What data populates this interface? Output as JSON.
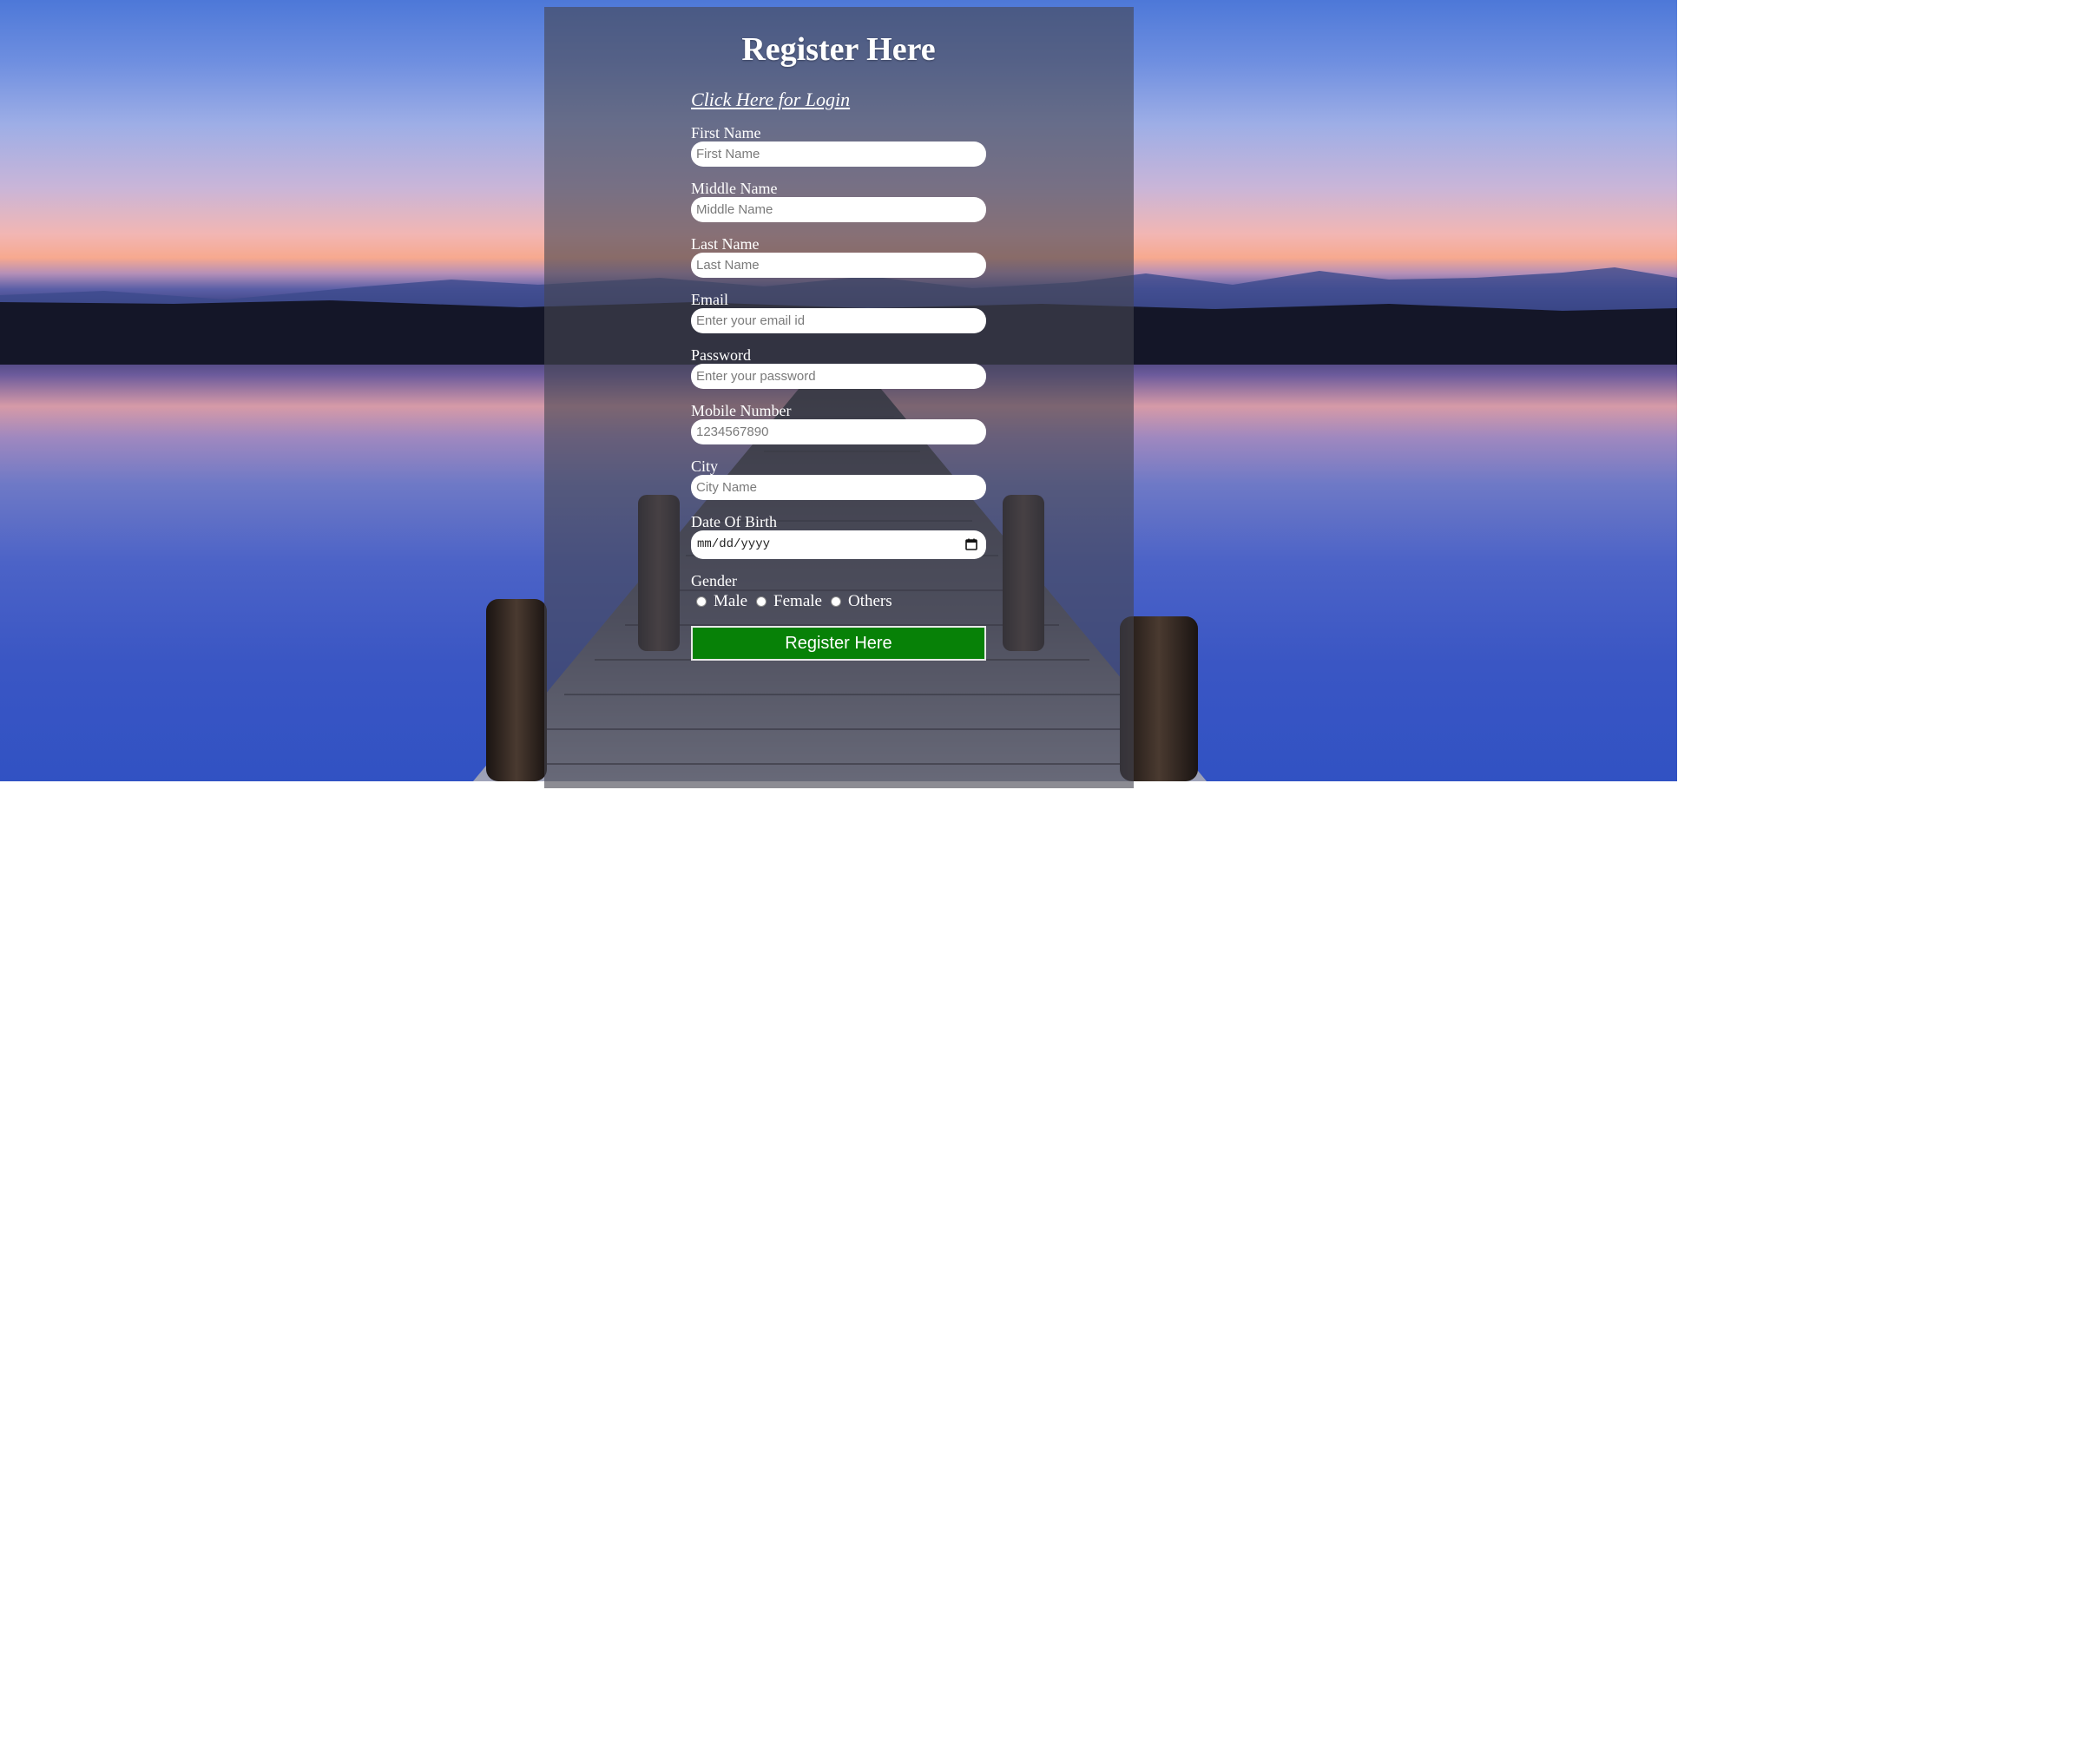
{
  "form": {
    "title": "Register Here",
    "login_link": "Click Here for Login",
    "fields": [
      {
        "label": "First Name",
        "placeholder": "First Name"
      },
      {
        "label": "Middle Name",
        "placeholder": "Middle Name"
      },
      {
        "label": "Last Name",
        "placeholder": "Last Name"
      },
      {
        "label": "Email",
        "placeholder": "Enter your email id"
      },
      {
        "label": "Password",
        "placeholder": "Enter your password"
      },
      {
        "label": "Mobile Number",
        "placeholder": "1234567890"
      },
      {
        "label": "City",
        "placeholder": "City Name"
      }
    ],
    "dob": {
      "label": "Date Of Birth",
      "placeholder": "mm/dd/yyyy"
    },
    "gender": {
      "label": "Gender",
      "options": [
        "Male",
        "Female",
        "Others"
      ]
    },
    "submit_label": "Register Here"
  },
  "colors": {
    "submit_bg": "#078107",
    "panel_overlay": "rgba(70,70,80,0.62)"
  },
  "icons": {
    "calendar": "calendar-icon"
  }
}
